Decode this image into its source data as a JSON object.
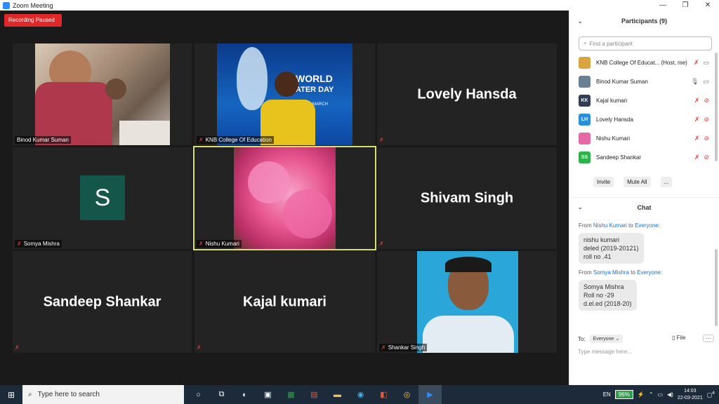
{
  "window": {
    "title": "Zoom Meeting",
    "minimize": "—",
    "restore": "❐",
    "close": "✕"
  },
  "recording": {
    "label": "Recording Paused"
  },
  "tiles": {
    "binod": {
      "name": "Binod Kumar Suman"
    },
    "knb": {
      "name": "KNB College Of Education"
    },
    "lovely": {
      "big": "Lovely Hansda"
    },
    "somya": {
      "name": "Somya Mishra",
      "avatar": "S"
    },
    "nishu": {
      "name": "Nishu Kumari"
    },
    "shivam": {
      "big": "Shivam Singh"
    },
    "sandeep": {
      "big": "Sandeep Shankar"
    },
    "kajal": {
      "big": "Kajal kumari"
    },
    "shankar": {
      "name": "Shankar Singh"
    }
  },
  "participants": {
    "title": "Participants (9)",
    "search_placeholder": "Find a participant",
    "list": [
      {
        "name": "KNB College Of Educat... (Host, me)",
        "initials": "",
        "color": "#d9a441"
      },
      {
        "name": "Binod Kumar Suman",
        "initials": "",
        "color": "#6b7f93"
      },
      {
        "name": "Kajal kumari",
        "initials": "KK",
        "color": "#2f3e54"
      },
      {
        "name": "Lovely Hansda",
        "initials": "LH",
        "color": "#2a8fd8"
      },
      {
        "name": "Nishu Kumari",
        "initials": "",
        "color": "#e36aa7"
      },
      {
        "name": "Sandeep Shankar",
        "initials": "SS",
        "color": "#2cb34a"
      }
    ],
    "invite": "Invite",
    "mute_all": "Mute All",
    "more": "..."
  },
  "chat": {
    "title": "Chat",
    "messages": [
      {
        "from": "Nishu Kumari",
        "to": "Everyone",
        "lines": [
          "nishu kumari",
          "deled (2019-20121)",
          "roll no .41"
        ]
      },
      {
        "from": "Somya Mishra",
        "to": "Everyone",
        "lines": [
          "Somya Mishra",
          "Roll no -29",
          "d.el.ed (2018-20)"
        ]
      }
    ],
    "from_word": "From",
    "to_word": "to",
    "to_label": "To:",
    "to_value": "Everyone",
    "file": "File",
    "input_placeholder": "Type message here..."
  },
  "taskbar": {
    "search": "Type here to search",
    "lang": "EN",
    "battery": "96%",
    "time": "14:03",
    "date": "22-03-2021",
    "notif": "4"
  }
}
